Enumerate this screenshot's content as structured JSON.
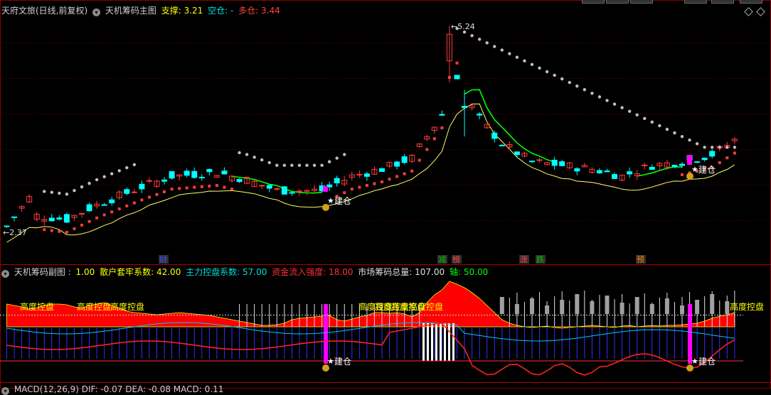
{
  "main_header": {
    "stock": "天府文旅(日线,前复权)",
    "indicator": "天机筹码主图",
    "support_label": "支撑:",
    "support_value": "3.21",
    "empty_label": "空仓:",
    "empty_value": "-",
    "long_label": "多仓:",
    "long_value": "3.44"
  },
  "sub_header": {
    "indicator": "天机筹码副图",
    "sep": ":",
    "p1": "1.00",
    "retail_label": "散户套牢系数:",
    "retail_value": "42.00",
    "main_label": "主力控盘系数:",
    "main_value": "57.00",
    "fund_label": "资金流入强度:",
    "fund_value": "18.00",
    "total_label": "市场筹码总量:",
    "total_value": "107.00",
    "axis_label": "轴:",
    "axis_value": "50.00"
  },
  "bottom_header": {
    "text": "MACD(12,26,9)  DIF: -0.07  DEA: -0.08  MACD: 0.11"
  },
  "price_labels": {
    "high": "5.24",
    "low": "2.37"
  },
  "markers": {
    "build": "建仓",
    "control": "高度控盘"
  },
  "event_tags": [
    "财",
    "减",
    "榜",
    "涨",
    "跌",
    "预"
  ],
  "colors": {
    "up": "#ff3b3b",
    "down": "#00ffff",
    "ma": "#ffff66",
    "trend": "#00ff00",
    "dots": "#c0c0c0",
    "magenta": "#ff00ff",
    "white": "#ffffff"
  },
  "icons": [
    "chevron-down-icon",
    "diamond-icon",
    "star-icon",
    "money-bag-icon"
  ]
}
